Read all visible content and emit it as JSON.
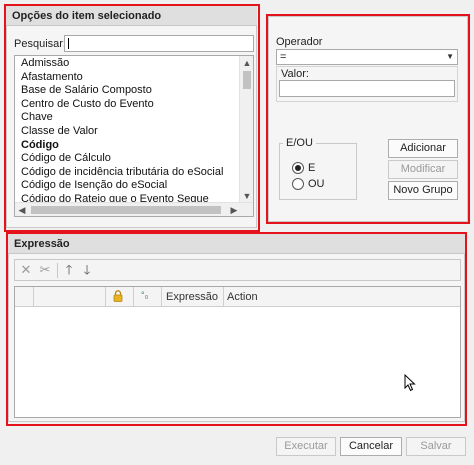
{
  "item_options": {
    "header": "Opções do item selecionado",
    "search_label": "Pesquisar:",
    "search_value": "",
    "items": [
      {
        "label": "Admissão",
        "bold": false
      },
      {
        "label": "Afastamento",
        "bold": false
      },
      {
        "label": "Base de Salário Composto",
        "bold": false
      },
      {
        "label": "Centro de Custo do Evento",
        "bold": false
      },
      {
        "label": "Chave",
        "bold": false
      },
      {
        "label": "Classe de Valor",
        "bold": false
      },
      {
        "label": "Código",
        "bold": true
      },
      {
        "label": "Código de Cálculo",
        "bold": false
      },
      {
        "label": "Código de incidência tributária do eSocial",
        "bold": false
      },
      {
        "label": "Código de Isenção do eSocial",
        "bold": false
      },
      {
        "label": "Código do Rateio que o Evento Segue",
        "bold": false
      }
    ]
  },
  "operator_panel": {
    "operator_label": "Operador",
    "operator_value": "=",
    "value_label": "Valor:",
    "value_value": "",
    "logic_legend": "E/OU",
    "radio_and": "E",
    "radio_or": "OU",
    "selected_logic": "E",
    "add_button": "Adicionar",
    "modify_button": "Modificar",
    "new_group_button": "Novo Grupo"
  },
  "expression": {
    "header": "Expressão",
    "columns": [
      "Expressão",
      "Action"
    ],
    "rows": []
  },
  "footer": {
    "execute": "Executar",
    "cancel": "Cancelar",
    "save": "Salvar"
  },
  "colors": {
    "highlight": "#e3121b",
    "background": "#f0f0f0"
  }
}
